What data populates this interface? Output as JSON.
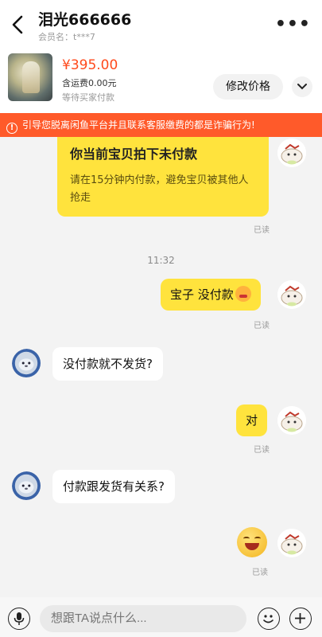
{
  "header": {
    "title": "泪光666666",
    "member": "会员名：t***7",
    "more": "•••"
  },
  "product": {
    "price": "¥395.00",
    "shipping": "含运费0.00元",
    "status": "等待买家付款",
    "modify_button": "修改价格"
  },
  "warning": {
    "icon": "!",
    "text": "引导您脱离闲鱼平台并且联系客服缴费的都是诈骗行为!"
  },
  "messages": {
    "card_title": "你当前宝贝拍下未付款",
    "card_body": "请在15分钟内付款，避免宝贝被其他人抢走",
    "read_1": "已读",
    "time": "11:32",
    "me_1": "宝子 没付款",
    "read_2": "已读",
    "other_1": "没付款就不发货?",
    "me_2": "对",
    "read_3": "已读",
    "other_2": "付款跟发货有关系?",
    "read_4": "已读"
  },
  "footer": {
    "placeholder": "想跟TA说点什么..."
  },
  "colors": {
    "accent": "#ffe33d",
    "warning": "#ff5a2a",
    "price": "#ff4a1c"
  }
}
